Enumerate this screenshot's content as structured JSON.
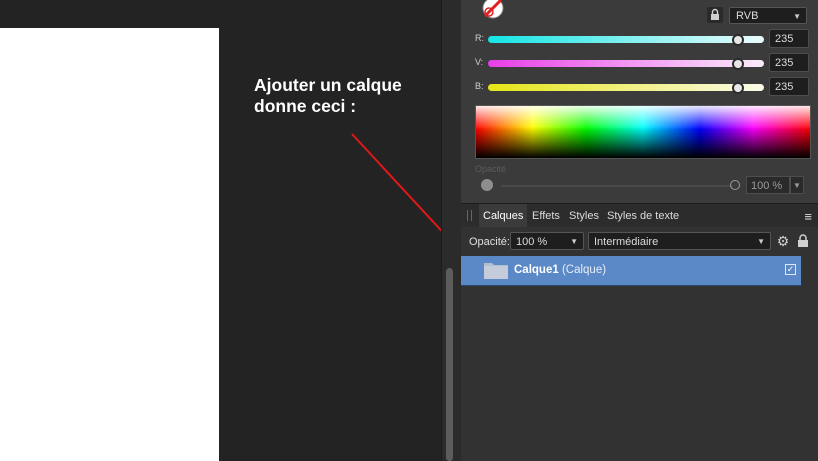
{
  "annotation": {
    "line1": "Ajouter un calque",
    "line2": "donne ceci :"
  },
  "colors": {
    "accent": "#5b88c6",
    "arrow": "#e01818",
    "canvas": "#ffffff"
  },
  "color_panel": {
    "mode": "RVB",
    "sliders": [
      {
        "label": "R:",
        "value": "235",
        "level": 0.92,
        "gradient": [
          "#15e5e5",
          "#ebfbfb"
        ]
      },
      {
        "label": "V:",
        "value": "235",
        "level": 0.92,
        "gradient": [
          "#e83ee8",
          "#fbecfb"
        ]
      },
      {
        "label": "B:",
        "value": "235",
        "level": 0.92,
        "gradient": [
          "#e5e515",
          "#fbfbeb"
        ]
      }
    ],
    "opacity_label": "Opacité",
    "opacity_value": "100 %"
  },
  "tabs": [
    {
      "label": "Calques",
      "active": true
    },
    {
      "label": "Effets",
      "active": false
    },
    {
      "label": "Styles",
      "active": false
    },
    {
      "label": "Styles de texte",
      "active": false
    }
  ],
  "layers_toolbar": {
    "opacity_label": "Opacité:",
    "opacity_value": "100 %",
    "blend_mode": "Intermédiaire"
  },
  "layer": {
    "name": "Calque1",
    "type": "(Calque)",
    "visible": true
  },
  "icons": [
    "no-fill-icon",
    "lock-icon",
    "gear-icon",
    "menu-icon",
    "folder-icon",
    "checkbox-icon",
    "chevron-down-icon",
    "grip-icon"
  ]
}
